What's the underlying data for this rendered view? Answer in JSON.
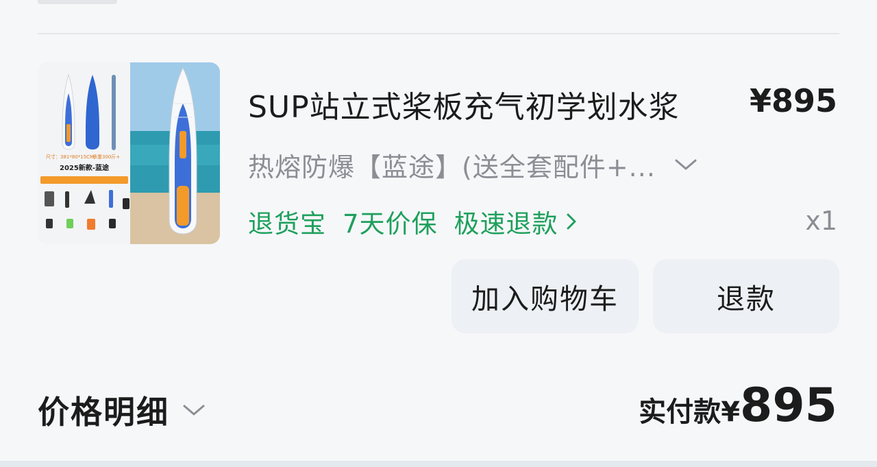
{
  "order_item": {
    "title": "SUP站立式桨板充气初学划水浆",
    "price": "¥895",
    "variant": "热熔防爆【蓝途】(送全套配件+...",
    "services": [
      "退货宝",
      "7天价保",
      "极速退款"
    ],
    "quantity": "x1",
    "image": {
      "size_label": "尺寸：381*80*15CM",
      "load_label": "承重300斤+",
      "model_label": "2025新款-蓝途"
    }
  },
  "actions": {
    "add_to_cart": "加入购物车",
    "refund": "退款"
  },
  "summary": {
    "price_detail_label": "价格明细",
    "paid_label": "实付款",
    "paid_currency": "¥",
    "paid_amount": "895"
  },
  "colors": {
    "service_green": "#1ea05c",
    "muted_gray": "#8b8e94",
    "button_bg": "#edf0f4"
  },
  "icons": [
    "chevron-down-icon",
    "chevron-right-icon"
  ]
}
